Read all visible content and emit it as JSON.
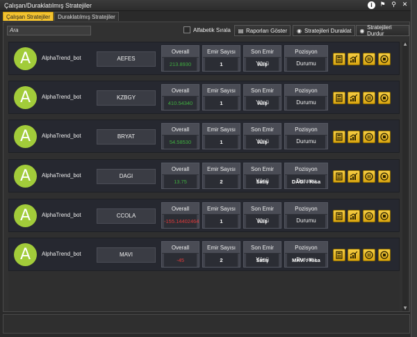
{
  "window": {
    "title": "Çalışan/Duraklatılmış Stratejiler",
    "icons": [
      "info-icon",
      "flag-icon",
      "pin-icon",
      "close-icon"
    ]
  },
  "tabs": [
    {
      "label": "Çalışan Stratejiler",
      "active": true
    },
    {
      "label": "Duraklatılmış Stratejiler",
      "active": false
    }
  ],
  "toolbar": {
    "search_placeholder": "Ara",
    "alphabetic_label": "Alfabetik Sırala",
    "alphabetic_checked": false,
    "report_label": "Raporları Göster",
    "pause_label": "Stratejileri Duraklat",
    "stop_label": "Stratejileri Durdur"
  },
  "headers": {
    "overall": "Overall",
    "orders": "Emir Sayısı",
    "last_dir": "Son Emir Yönü",
    "position": "Pozisyon Durumu"
  },
  "colors": {
    "accent": "#f2c230",
    "avatar": "#a2cc3a",
    "positive": "#3fae3f",
    "negative": "#e23a3a"
  },
  "rows": [
    {
      "avatar": "A",
      "bot": "AlphaTrend_bot",
      "symbol": "AEFES",
      "overall": "213.8930",
      "overall_sign": "green",
      "orders": "1",
      "last_dir": "Alış",
      "position": ""
    },
    {
      "avatar": "A",
      "bot": "AlphaTrend_bot",
      "symbol": "KZBGY",
      "overall": "410.54340",
      "overall_sign": "green",
      "orders": "1",
      "last_dir": "Alış",
      "position": ""
    },
    {
      "avatar": "A",
      "bot": "AlphaTrend_bot",
      "symbol": "BRYAT",
      "overall": "54.58530",
      "overall_sign": "green",
      "orders": "1",
      "last_dir": "Alış",
      "position": ""
    },
    {
      "avatar": "A",
      "bot": "AlphaTrend_bot",
      "symbol": "DAGI",
      "overall": "13.75",
      "overall_sign": "green",
      "orders": "2",
      "last_dir": "Satış",
      "position": "DAGI : Kısa"
    },
    {
      "avatar": "A",
      "bot": "AlphaTrend_bot",
      "symbol": "CCOLA",
      "overall": "-155.14402464",
      "overall_sign": "red",
      "orders": "1",
      "last_dir": "Alış",
      "position": ""
    },
    {
      "avatar": "A",
      "bot": "AlphaTrend_bot",
      "symbol": "MAVI",
      "overall": "-45",
      "overall_sign": "red",
      "orders": "2",
      "last_dir": "Satış",
      "position": "MAVI : Kısa"
    }
  ],
  "row_actions": [
    "calculator-icon",
    "chart-icon",
    "pause-icon",
    "stop-icon"
  ]
}
